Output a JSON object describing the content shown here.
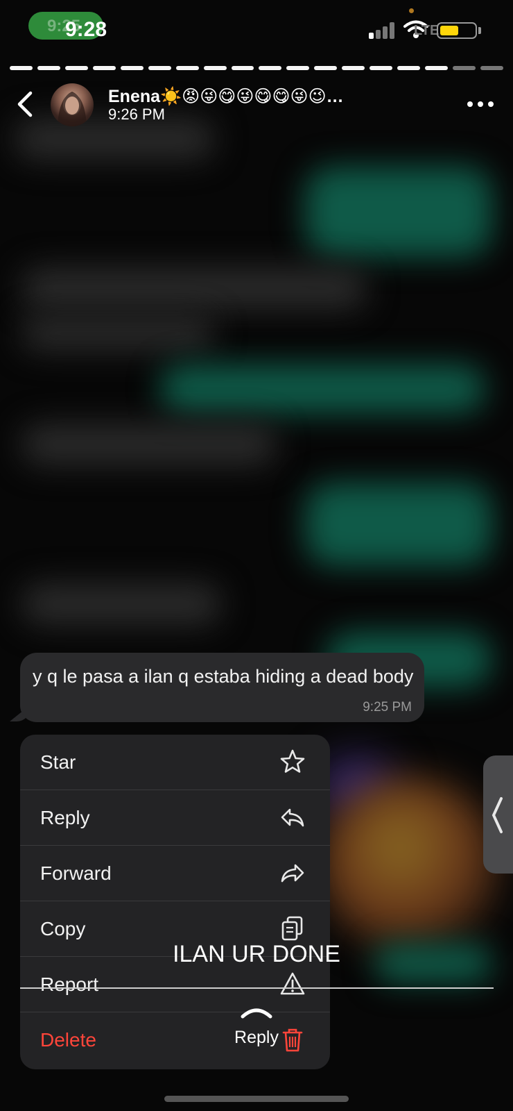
{
  "status_bar": {
    "pill_time": "9:25",
    "time": "9:28",
    "signal_icon": "cellular-signal-icon",
    "wifi_icon": "wifi-icon",
    "lte_text": "LTE",
    "battery_level": 0.55,
    "battery_color": "#ffd60a"
  },
  "story_progress": {
    "segments": 18,
    "completed": 16
  },
  "header": {
    "back_icon": "chevron-left-icon",
    "contact_name": "Enena☀️😡😜😋😜😋😋😜😉…",
    "subtitle": "9:26 PM",
    "more_icon": "ellipsis-icon"
  },
  "message": {
    "text": "y q le pasa a ilan q estaba hiding a dead body",
    "time": "9:25 PM"
  },
  "menu": {
    "items": [
      {
        "label": "Star",
        "icon": "star-icon"
      },
      {
        "label": "Reply",
        "icon": "reply-icon"
      },
      {
        "label": "Forward",
        "icon": "forward-icon"
      },
      {
        "label": "Copy",
        "icon": "copy-icon"
      },
      {
        "label": "Report",
        "icon": "warning-icon"
      },
      {
        "label": "Delete",
        "icon": "trash-icon"
      }
    ],
    "danger_color": "#ff453a"
  },
  "overlay": {
    "caption": "ILAN UR DONE",
    "swipe_label": "Reply",
    "swipe_icon": "chevron-up-icon"
  },
  "colors": {
    "teal_bubble": "#0f5a48",
    "accent_green": "#2e8b3a"
  }
}
